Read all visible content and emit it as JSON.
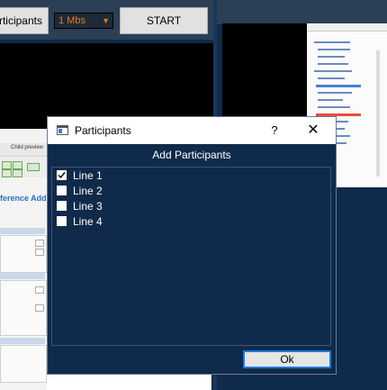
{
  "toolbar": {
    "participants_label": "articipants",
    "rate_value": "1 Mbs",
    "start_label": "START"
  },
  "dialog": {
    "title": "Participants",
    "help_label": "?",
    "close_label": "✕",
    "header": "Add Participants",
    "items": [
      {
        "label": "Line 1",
        "checked": true
      },
      {
        "label": "Line 2",
        "checked": false
      },
      {
        "label": "Line 3",
        "checked": false
      },
      {
        "label": "Line 4",
        "checked": false
      }
    ],
    "ok_label": "Ok"
  },
  "background_doc": {
    "title_fragment": "ference Addo",
    "tab_label": "Child preview"
  },
  "icons": {
    "app": "window-icon",
    "check": "checkmark-icon",
    "dropdown": "chevron-down-icon"
  },
  "colors": {
    "background": "#0f2a4a",
    "rate_text": "#e07b1b",
    "ok_focus": "#1b7be0"
  }
}
